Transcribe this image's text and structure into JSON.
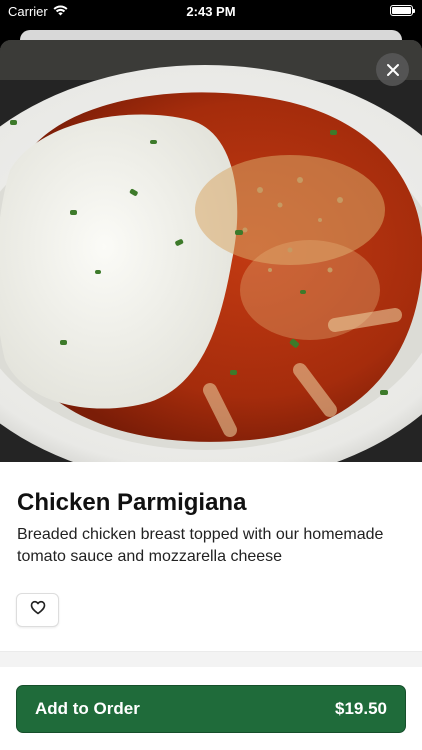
{
  "status_bar": {
    "carrier": "Carrier",
    "time": "2:43 PM",
    "icons": [
      "wifi-icon",
      "battery-icon"
    ]
  },
  "hero_image": {
    "description_icon": "food-photo",
    "close_icon": "close-icon"
  },
  "item": {
    "name": "Chicken Parmigiana",
    "description": "Breaded chicken breast topped with our homemade tomato sauce and mozzarella cheese",
    "favorite_icon": "heart-icon"
  },
  "order_button": {
    "label": "Add to Order",
    "price": "$19.50",
    "color": "#1f6b3a"
  }
}
